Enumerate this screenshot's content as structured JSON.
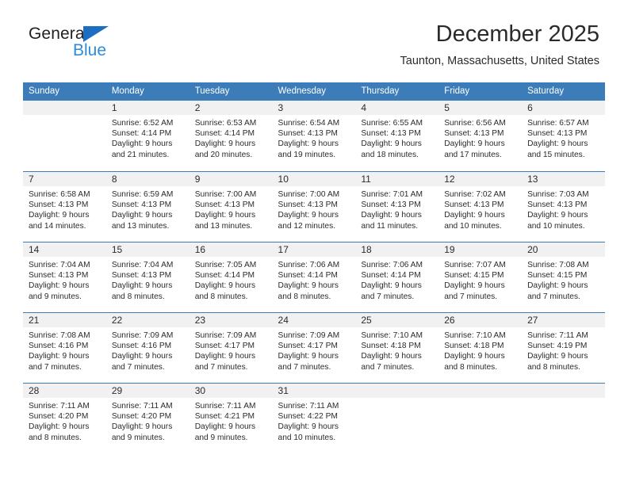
{
  "brand": {
    "name_part1": "General",
    "name_part2": "Blue",
    "triangle_color": "#1b6ec2",
    "text_color": "#231f20",
    "blue_color": "#2e8bd8"
  },
  "header": {
    "title": "December 2025",
    "subtitle": "Taunton, Massachusetts, United States"
  },
  "theme": {
    "header_blue": "#3b7cb9",
    "day_band_gray": "#f1f1f1",
    "text": "#2b2b2b"
  },
  "weekdays": [
    "Sunday",
    "Monday",
    "Tuesday",
    "Wednesday",
    "Thursday",
    "Friday",
    "Saturday"
  ],
  "weeks": [
    [
      {
        "day": "",
        "empty": true,
        "sunrise": "",
        "sunset": "",
        "daylight_line1": "",
        "daylight_line2": ""
      },
      {
        "day": "1",
        "sunrise": "Sunrise: 6:52 AM",
        "sunset": "Sunset: 4:14 PM",
        "daylight_line1": "Daylight: 9 hours",
        "daylight_line2": "and 21 minutes."
      },
      {
        "day": "2",
        "sunrise": "Sunrise: 6:53 AM",
        "sunset": "Sunset: 4:14 PM",
        "daylight_line1": "Daylight: 9 hours",
        "daylight_line2": "and 20 minutes."
      },
      {
        "day": "3",
        "sunrise": "Sunrise: 6:54 AM",
        "sunset": "Sunset: 4:13 PM",
        "daylight_line1": "Daylight: 9 hours",
        "daylight_line2": "and 19 minutes."
      },
      {
        "day": "4",
        "sunrise": "Sunrise: 6:55 AM",
        "sunset": "Sunset: 4:13 PM",
        "daylight_line1": "Daylight: 9 hours",
        "daylight_line2": "and 18 minutes."
      },
      {
        "day": "5",
        "sunrise": "Sunrise: 6:56 AM",
        "sunset": "Sunset: 4:13 PM",
        "daylight_line1": "Daylight: 9 hours",
        "daylight_line2": "and 17 minutes."
      },
      {
        "day": "6",
        "sunrise": "Sunrise: 6:57 AM",
        "sunset": "Sunset: 4:13 PM",
        "daylight_line1": "Daylight: 9 hours",
        "daylight_line2": "and 15 minutes."
      }
    ],
    [
      {
        "day": "7",
        "sunrise": "Sunrise: 6:58 AM",
        "sunset": "Sunset: 4:13 PM",
        "daylight_line1": "Daylight: 9 hours",
        "daylight_line2": "and 14 minutes."
      },
      {
        "day": "8",
        "sunrise": "Sunrise: 6:59 AM",
        "sunset": "Sunset: 4:13 PM",
        "daylight_line1": "Daylight: 9 hours",
        "daylight_line2": "and 13 minutes."
      },
      {
        "day": "9",
        "sunrise": "Sunrise: 7:00 AM",
        "sunset": "Sunset: 4:13 PM",
        "daylight_line1": "Daylight: 9 hours",
        "daylight_line2": "and 13 minutes."
      },
      {
        "day": "10",
        "sunrise": "Sunrise: 7:00 AM",
        "sunset": "Sunset: 4:13 PM",
        "daylight_line1": "Daylight: 9 hours",
        "daylight_line2": "and 12 minutes."
      },
      {
        "day": "11",
        "sunrise": "Sunrise: 7:01 AM",
        "sunset": "Sunset: 4:13 PM",
        "daylight_line1": "Daylight: 9 hours",
        "daylight_line2": "and 11 minutes."
      },
      {
        "day": "12",
        "sunrise": "Sunrise: 7:02 AM",
        "sunset": "Sunset: 4:13 PM",
        "daylight_line1": "Daylight: 9 hours",
        "daylight_line2": "and 10 minutes."
      },
      {
        "day": "13",
        "sunrise": "Sunrise: 7:03 AM",
        "sunset": "Sunset: 4:13 PM",
        "daylight_line1": "Daylight: 9 hours",
        "daylight_line2": "and 10 minutes."
      }
    ],
    [
      {
        "day": "14",
        "sunrise": "Sunrise: 7:04 AM",
        "sunset": "Sunset: 4:13 PM",
        "daylight_line1": "Daylight: 9 hours",
        "daylight_line2": "and 9 minutes."
      },
      {
        "day": "15",
        "sunrise": "Sunrise: 7:04 AM",
        "sunset": "Sunset: 4:13 PM",
        "daylight_line1": "Daylight: 9 hours",
        "daylight_line2": "and 8 minutes."
      },
      {
        "day": "16",
        "sunrise": "Sunrise: 7:05 AM",
        "sunset": "Sunset: 4:14 PM",
        "daylight_line1": "Daylight: 9 hours",
        "daylight_line2": "and 8 minutes."
      },
      {
        "day": "17",
        "sunrise": "Sunrise: 7:06 AM",
        "sunset": "Sunset: 4:14 PM",
        "daylight_line1": "Daylight: 9 hours",
        "daylight_line2": "and 8 minutes."
      },
      {
        "day": "18",
        "sunrise": "Sunrise: 7:06 AM",
        "sunset": "Sunset: 4:14 PM",
        "daylight_line1": "Daylight: 9 hours",
        "daylight_line2": "and 7 minutes."
      },
      {
        "day": "19",
        "sunrise": "Sunrise: 7:07 AM",
        "sunset": "Sunset: 4:15 PM",
        "daylight_line1": "Daylight: 9 hours",
        "daylight_line2": "and 7 minutes."
      },
      {
        "day": "20",
        "sunrise": "Sunrise: 7:08 AM",
        "sunset": "Sunset: 4:15 PM",
        "daylight_line1": "Daylight: 9 hours",
        "daylight_line2": "and 7 minutes."
      }
    ],
    [
      {
        "day": "21",
        "sunrise": "Sunrise: 7:08 AM",
        "sunset": "Sunset: 4:16 PM",
        "daylight_line1": "Daylight: 9 hours",
        "daylight_line2": "and 7 minutes."
      },
      {
        "day": "22",
        "sunrise": "Sunrise: 7:09 AM",
        "sunset": "Sunset: 4:16 PM",
        "daylight_line1": "Daylight: 9 hours",
        "daylight_line2": "and 7 minutes."
      },
      {
        "day": "23",
        "sunrise": "Sunrise: 7:09 AM",
        "sunset": "Sunset: 4:17 PM",
        "daylight_line1": "Daylight: 9 hours",
        "daylight_line2": "and 7 minutes."
      },
      {
        "day": "24",
        "sunrise": "Sunrise: 7:09 AM",
        "sunset": "Sunset: 4:17 PM",
        "daylight_line1": "Daylight: 9 hours",
        "daylight_line2": "and 7 minutes."
      },
      {
        "day": "25",
        "sunrise": "Sunrise: 7:10 AM",
        "sunset": "Sunset: 4:18 PM",
        "daylight_line1": "Daylight: 9 hours",
        "daylight_line2": "and 7 minutes."
      },
      {
        "day": "26",
        "sunrise": "Sunrise: 7:10 AM",
        "sunset": "Sunset: 4:18 PM",
        "daylight_line1": "Daylight: 9 hours",
        "daylight_line2": "and 8 minutes."
      },
      {
        "day": "27",
        "sunrise": "Sunrise: 7:11 AM",
        "sunset": "Sunset: 4:19 PM",
        "daylight_line1": "Daylight: 9 hours",
        "daylight_line2": "and 8 minutes."
      }
    ],
    [
      {
        "day": "28",
        "sunrise": "Sunrise: 7:11 AM",
        "sunset": "Sunset: 4:20 PM",
        "daylight_line1": "Daylight: 9 hours",
        "daylight_line2": "and 8 minutes."
      },
      {
        "day": "29",
        "sunrise": "Sunrise: 7:11 AM",
        "sunset": "Sunset: 4:20 PM",
        "daylight_line1": "Daylight: 9 hours",
        "daylight_line2": "and 9 minutes."
      },
      {
        "day": "30",
        "sunrise": "Sunrise: 7:11 AM",
        "sunset": "Sunset: 4:21 PM",
        "daylight_line1": "Daylight: 9 hours",
        "daylight_line2": "and 9 minutes."
      },
      {
        "day": "31",
        "sunrise": "Sunrise: 7:11 AM",
        "sunset": "Sunset: 4:22 PM",
        "daylight_line1": "Daylight: 9 hours",
        "daylight_line2": "and 10 minutes."
      },
      {
        "day": "",
        "empty": true,
        "sunrise": "",
        "sunset": "",
        "daylight_line1": "",
        "daylight_line2": ""
      },
      {
        "day": "",
        "empty": true,
        "sunrise": "",
        "sunset": "",
        "daylight_line1": "",
        "daylight_line2": ""
      },
      {
        "day": "",
        "empty": true,
        "sunrise": "",
        "sunset": "",
        "daylight_line1": "",
        "daylight_line2": ""
      }
    ]
  ]
}
